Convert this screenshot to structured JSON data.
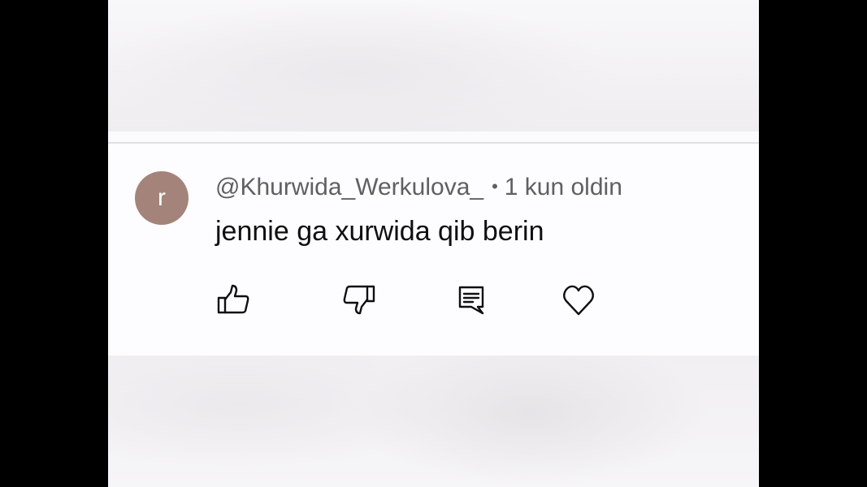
{
  "comment": {
    "avatar_letter": "r",
    "avatar_color": "#a4847a",
    "author": "@Khurwida_Werkulova_",
    "separator": "•",
    "timestamp": "1 kun oldin",
    "text": "jennie ga xurwida qib berin"
  },
  "actions": {
    "icons": [
      "thumbs-up-icon",
      "thumbs-down-icon",
      "reply-icon",
      "heart-icon"
    ]
  }
}
